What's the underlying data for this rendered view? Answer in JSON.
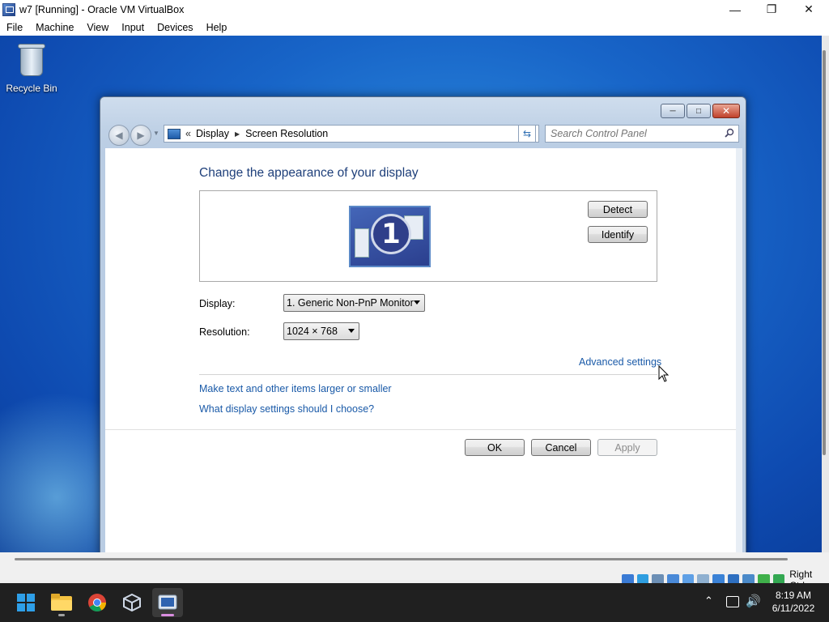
{
  "host": {
    "title": "w7 [Running] - Oracle VM VirtualBox",
    "menu": [
      "File",
      "Machine",
      "View",
      "Input",
      "Devices",
      "Help"
    ],
    "host_key": "Right Ctrl",
    "clock_time": "8:19 AM",
    "clock_date": "6/11/2022"
  },
  "desktop": {
    "recycle_bin_label": "Recycle Bin"
  },
  "control_panel": {
    "breadcrumb_chevron": "«",
    "breadcrumbs": [
      "Display",
      "Screen Resolution"
    ],
    "search_placeholder": "Search Control Panel",
    "page_title": "Change the appearance of your display",
    "monitor_number": "1",
    "detect_label": "Detect",
    "identify_label": "Identify",
    "display_label": "Display:",
    "display_value": "1. Generic Non-PnP Monitor",
    "resolution_label": "Resolution:",
    "resolution_value": "1024 × 768",
    "advanced_link": "Advanced settings",
    "text_size_link": "Make text and other items larger or smaller",
    "which_settings_link": "What display settings should I choose?",
    "ok_label": "OK",
    "cancel_label": "Cancel",
    "apply_label": "Apply"
  },
  "icons": {
    "status_icon_colors": [
      "#3a7bd5",
      "#2f9ee0",
      "#6c8fb5",
      "#4a8ad8",
      "#5fa0e6",
      "#8fb0d0",
      "#3b82d6",
      "#2e6fc0",
      "#4b8ac9",
      "#3fb04a",
      "#33a852"
    ]
  }
}
